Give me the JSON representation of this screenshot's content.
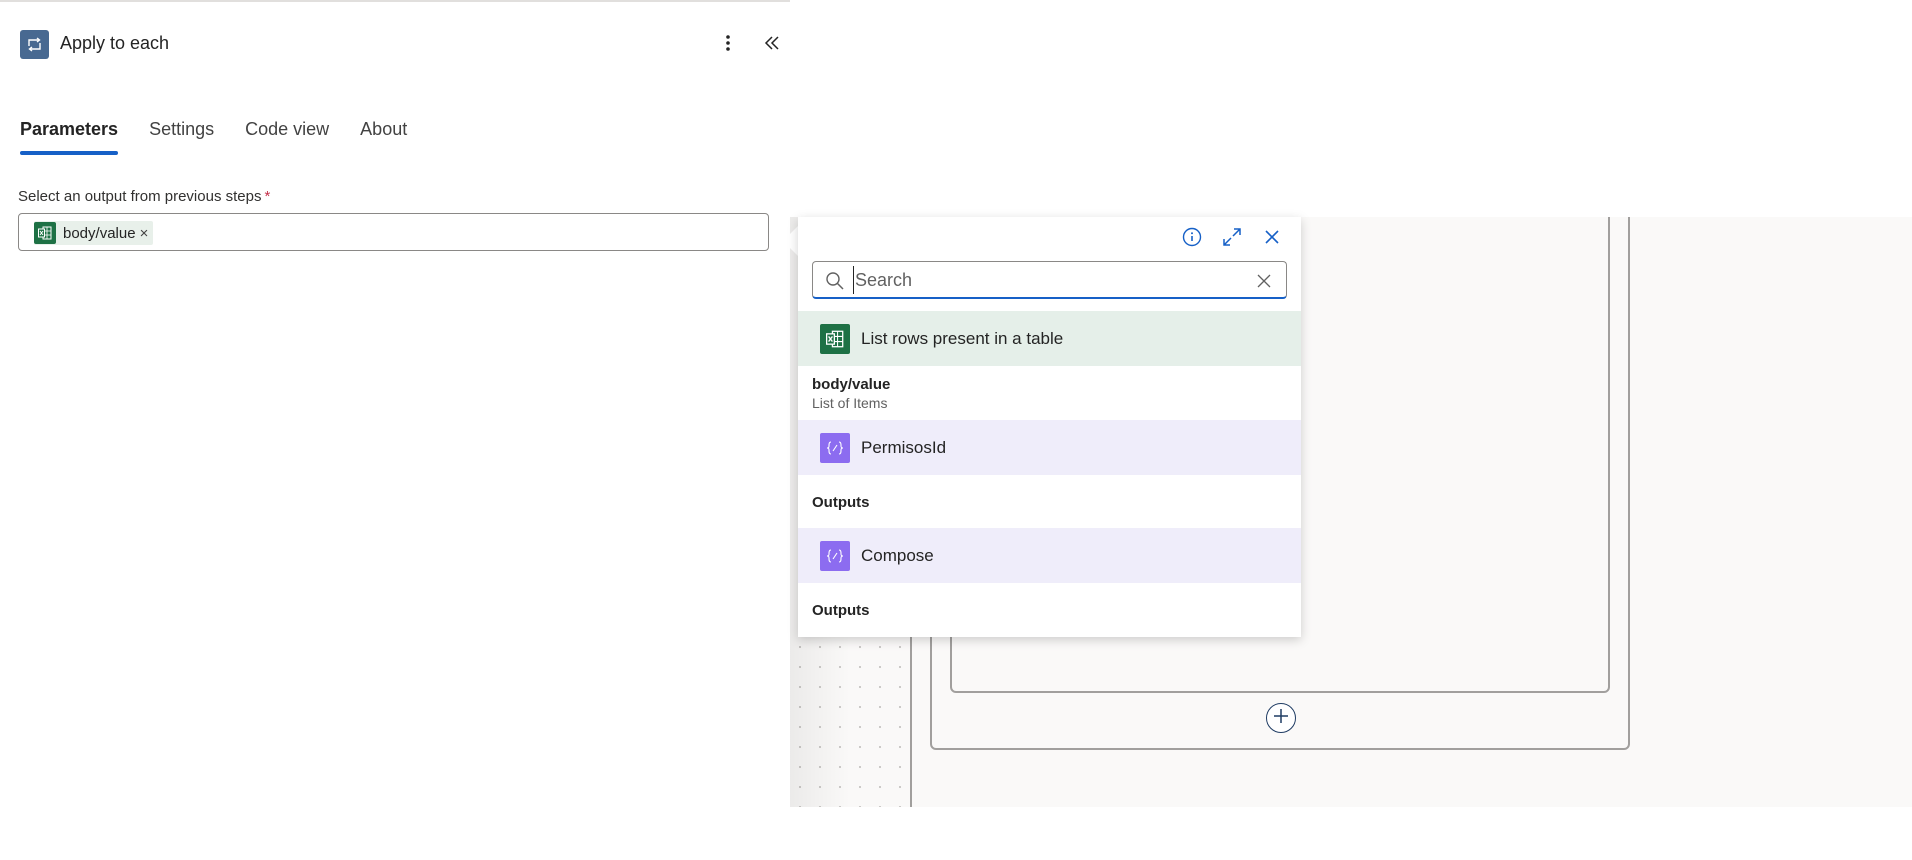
{
  "header": {
    "title": "Apply to each",
    "more_options_label": "More options",
    "collapse_label": "Collapse"
  },
  "tabs": [
    {
      "label": "Parameters",
      "active": true
    },
    {
      "label": "Settings",
      "active": false
    },
    {
      "label": "Code view",
      "active": false
    },
    {
      "label": "About",
      "active": false
    }
  ],
  "parameters": {
    "field_label": "Select an output from previous steps",
    "required_marker": "*",
    "token": {
      "label": "body/value",
      "remove_glyph": "×",
      "icon": "excel-icon"
    }
  },
  "flyout": {
    "search": {
      "placeholder": "Search",
      "value": ""
    },
    "top_buttons": [
      "info-icon",
      "expand-icon",
      "close-icon"
    ],
    "groups": [
      {
        "title": "List rows present in a table",
        "icon": "excel-icon",
        "items": [
          {
            "title": "body/value",
            "subtitle": "List of Items"
          }
        ]
      },
      {
        "title": "PermisosId",
        "icon": "compose-icon",
        "items": [
          {
            "title": "Outputs",
            "subtitle": ""
          }
        ]
      },
      {
        "title": "Compose",
        "icon": "compose-icon",
        "items": [
          {
            "title": "Outputs",
            "subtitle": ""
          }
        ]
      }
    ]
  },
  "colors": {
    "accent": "#1660c7",
    "action_icon": "#486991",
    "excel": "#1e7145",
    "compose": "#8c6cf0",
    "excel_row_bg": "#e5efe9",
    "compose_row_bg": "#efedfa",
    "required": "#c4314b"
  }
}
